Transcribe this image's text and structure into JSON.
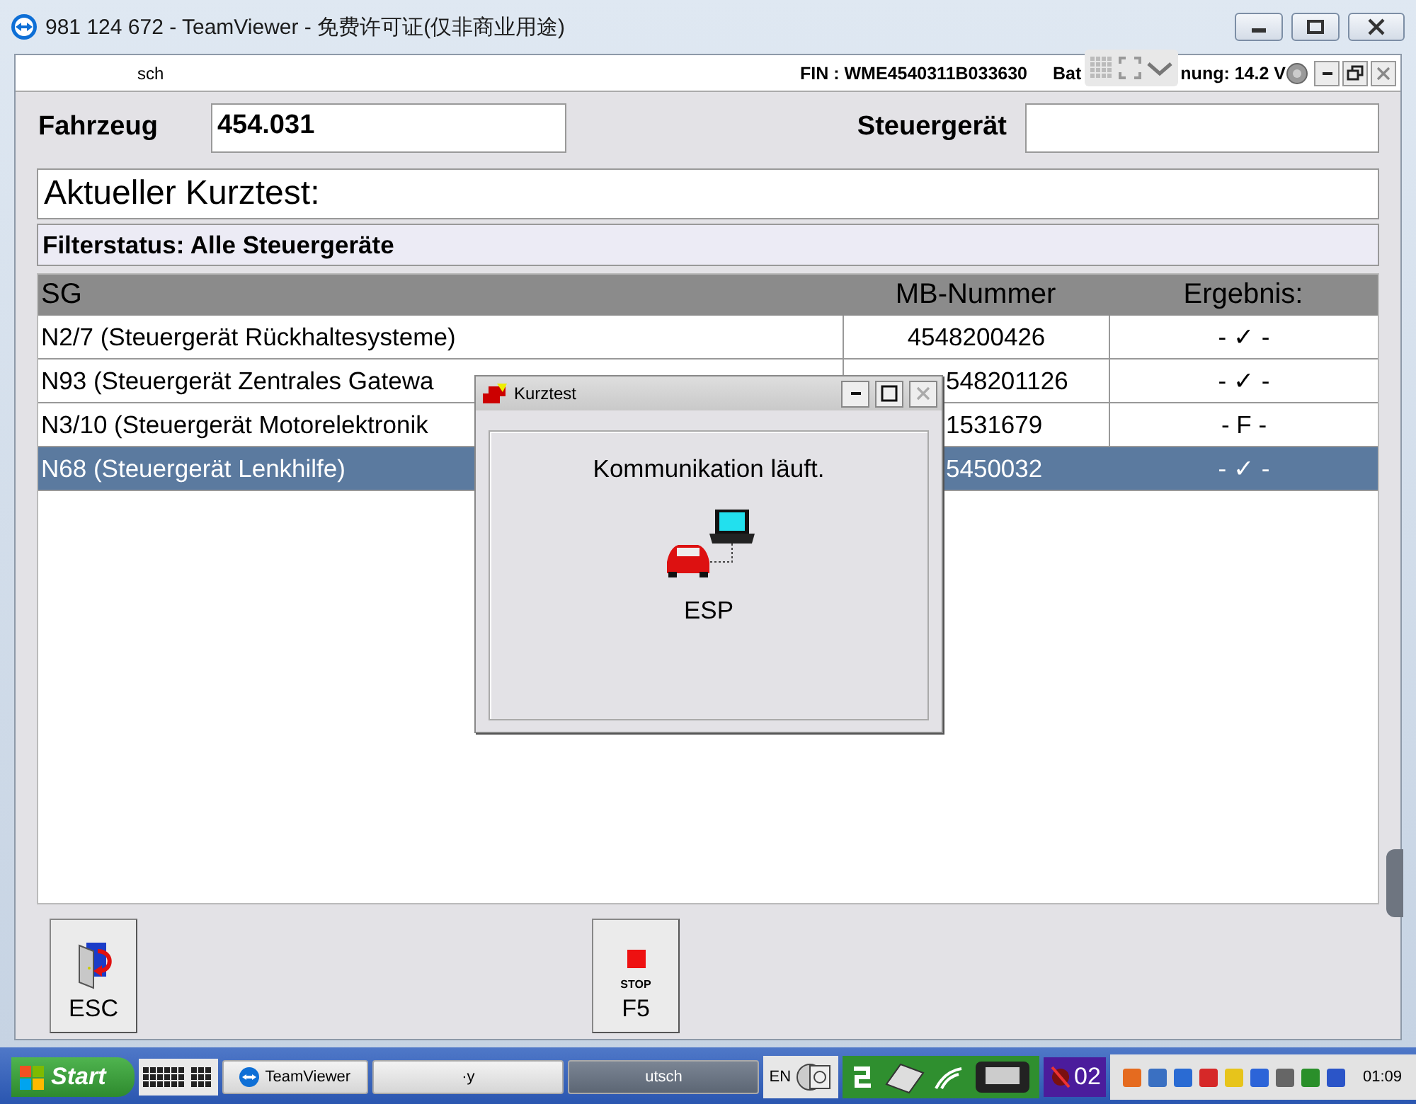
{
  "window": {
    "title": "981 124 672 - TeamViewer - 免费许可证(仅非商业用途)"
  },
  "header": {
    "user": "sch",
    "fin": "FIN : WME4540311B033630",
    "battery_start": "Bat",
    "battery_end": "nung: 14.2 V"
  },
  "form": {
    "vehicle_label": "Fahrzeug",
    "vehicle_value": "454.031",
    "ecu_label": "Steuergerät"
  },
  "test_title": "Aktueller Kurztest:",
  "filter_status": "Filterstatus: Alle Steuergeräte",
  "table": {
    "columns": [
      "SG",
      "MB-Nummer",
      "Ergebnis:"
    ],
    "rows": [
      {
        "sg": "N2/7 (Steuergerät Rückhaltesysteme)",
        "mb": "4548200426",
        "result": "- ✓ -",
        "selected": false
      },
      {
        "sg": "N93 (Steuergerät Zentrales Gatewa",
        "mb": "548201126",
        "result": "- ✓ -",
        "selected": false
      },
      {
        "sg": "N3/10 (Steuergerät Motorelektronik",
        "mb": "1531679",
        "result": "- F -",
        "selected": false
      },
      {
        "sg": "N68 (Steuergerät Lenkhilfe)",
        "mb": "5450032",
        "result": "- ✓ -",
        "selected": true
      }
    ]
  },
  "dialog": {
    "title": "Kurztest",
    "message": "Kommunikation läuft.",
    "module": "ESP"
  },
  "buttons": [
    {
      "kind": "esc",
      "label": "ESC"
    },
    {
      "kind": "stop",
      "caption": "STOP",
      "label": "F5"
    }
  ],
  "taskbar": {
    "start": "Start",
    "tasks": [
      {
        "label": "TeamViewer",
        "selected": false
      },
      {
        "label": "·y",
        "selected": false
      },
      {
        "label": "utsch",
        "selected": true
      }
    ],
    "language": "EN",
    "badge": "02",
    "clock": "01:09"
  }
}
